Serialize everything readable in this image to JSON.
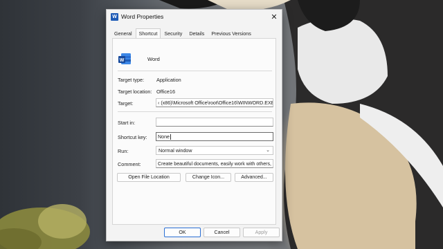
{
  "window": {
    "title": "Word Properties",
    "icon": "word-app-icon"
  },
  "tabs": [
    {
      "label": "General"
    },
    {
      "label": "Shortcut",
      "active": true
    },
    {
      "label": "Security"
    },
    {
      "label": "Details"
    },
    {
      "label": "Previous Versions"
    }
  ],
  "shortcut": {
    "app_name": "Word",
    "target_type_label": "Target type:",
    "target_type_value": "Application",
    "target_location_label": "Target location:",
    "target_location_value": "Office16",
    "target_label": "Target:",
    "target_value": "‹ (x86)\\Microsoft Office\\root\\Office16\\WINWORD.EXE\"",
    "start_in_label": "Start in:",
    "start_in_value": "",
    "shortcut_key_label": "Shortcut key:",
    "shortcut_key_value": "None",
    "run_label": "Run:",
    "run_value": "Normal window",
    "comment_label": "Comment:",
    "comment_value": "Create beautiful documents, easily work with others, a",
    "open_file_location": "Open File Location",
    "change_icon": "Change Icon...",
    "advanced": "Advanced..."
  },
  "footer": {
    "ok": "OK",
    "cancel": "Cancel",
    "apply": "Apply"
  },
  "colors": {
    "accent": "#2a6fd4",
    "word_blue": "#1e5bb6"
  }
}
